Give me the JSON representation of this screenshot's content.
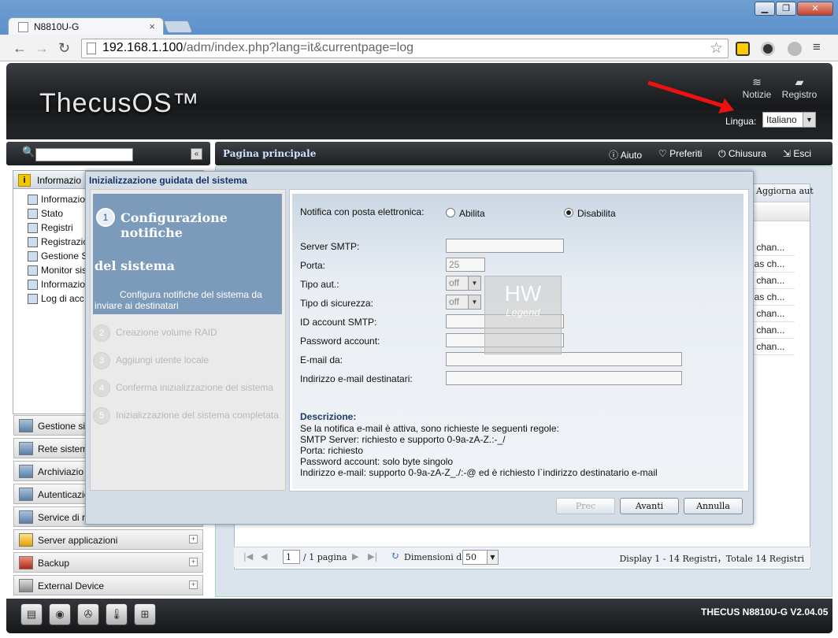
{
  "browser": {
    "tab_title": "N8810U-G",
    "url_host": "192.168.1.100",
    "url_path": "/adm/index.php?lang=it&currentpage=log",
    "min": "▁",
    "max": "❐",
    "close": "✕"
  },
  "header": {
    "logo": "ThecusOS™",
    "notizie": "Notizie",
    "registro": "Registro",
    "lingua_label": "Lingua:",
    "lingua_value": "Italiano"
  },
  "topbar": {
    "title": "Pagina principale",
    "aiuto": "Aiuto",
    "preferiti": "Preferiti",
    "chiusura": "Chiusura",
    "esci": "Esci"
  },
  "sidebar": {
    "head": "Informazio",
    "items": [
      "Informazio",
      "Stato",
      "Registri",
      "Registrazio",
      "Gestione S",
      "Monitor sis",
      "Informazio",
      "Log di acc"
    ],
    "menus": [
      "Gestione si",
      "Rete sistem",
      "Archiviazio",
      "Autenticazione utente e gruppo",
      "Service di rete",
      "Server applicazioni",
      "Backup",
      "External Device"
    ]
  },
  "grid": {
    "aggiorna": "Aggiorna aut",
    "rows": [
      "s chan...",
      "has ch...",
      "s chan...",
      "has ch...",
      "s chan...",
      "s chan...",
      "s chan..."
    ],
    "pager": {
      "page": "1",
      "of": "/ 1 pagina",
      "dim_label": "Dimensioni dati",
      "size": "50",
      "display": "Display 1 - 14 Registri，Totale 14 Registri"
    }
  },
  "wizard": {
    "title": "Inizializzazione guidata del sistema",
    "step1": {
      "num": "1",
      "title_a": "Configurazione notifiche",
      "title_b": "del sistema",
      "desc": "Configura notifiche del sistema da inviare ai destinatari"
    },
    "steps": [
      {
        "n": "2",
        "label": "Creazione volume RAID"
      },
      {
        "n": "3",
        "label": "Aggiungi utente locale"
      },
      {
        "n": "4",
        "label": "Conferma inizializzazione del sistema"
      },
      {
        "n": "5",
        "label": "Inizializzazione del sistema completata"
      }
    ],
    "form": {
      "notifica": "Notifica con posta elettronica:",
      "abilita": "Abilita",
      "disabilita": "Disabilita",
      "smtp": "Server SMTP:",
      "porta": "Porta:",
      "porta_val": "25",
      "tipo_aut": "Tipo aut.:",
      "tipo_aut_val": "off",
      "tipo_sic": "Tipo di sicurezza:",
      "tipo_sic_val": "off",
      "id_account": "ID account SMTP:",
      "password": "Password account:",
      "email_da": "E-mail da:",
      "destinatari": "Indirizzo e-mail destinatari:"
    },
    "descrizione": {
      "title": "Descrizione:",
      "lines": [
        "Se la notifica e-mail è attiva, sono richieste le seguenti regole:",
        "SMTP Server: richiesto e supporto 0-9a-zA-Z.:-_/",
        "Porta: richiesto",
        "Password account: solo byte singolo",
        "Indirizzo e-mail: supporto 0-9a-zA-Z_./:-@ ed è richiesto l`indirizzo destinatario e-mail"
      ]
    },
    "buttons": {
      "prev": "Prec",
      "next": "Avanti",
      "cancel": "Annulla"
    }
  },
  "footer": {
    "version": "THECUS N8810U-G V2.04.05"
  }
}
